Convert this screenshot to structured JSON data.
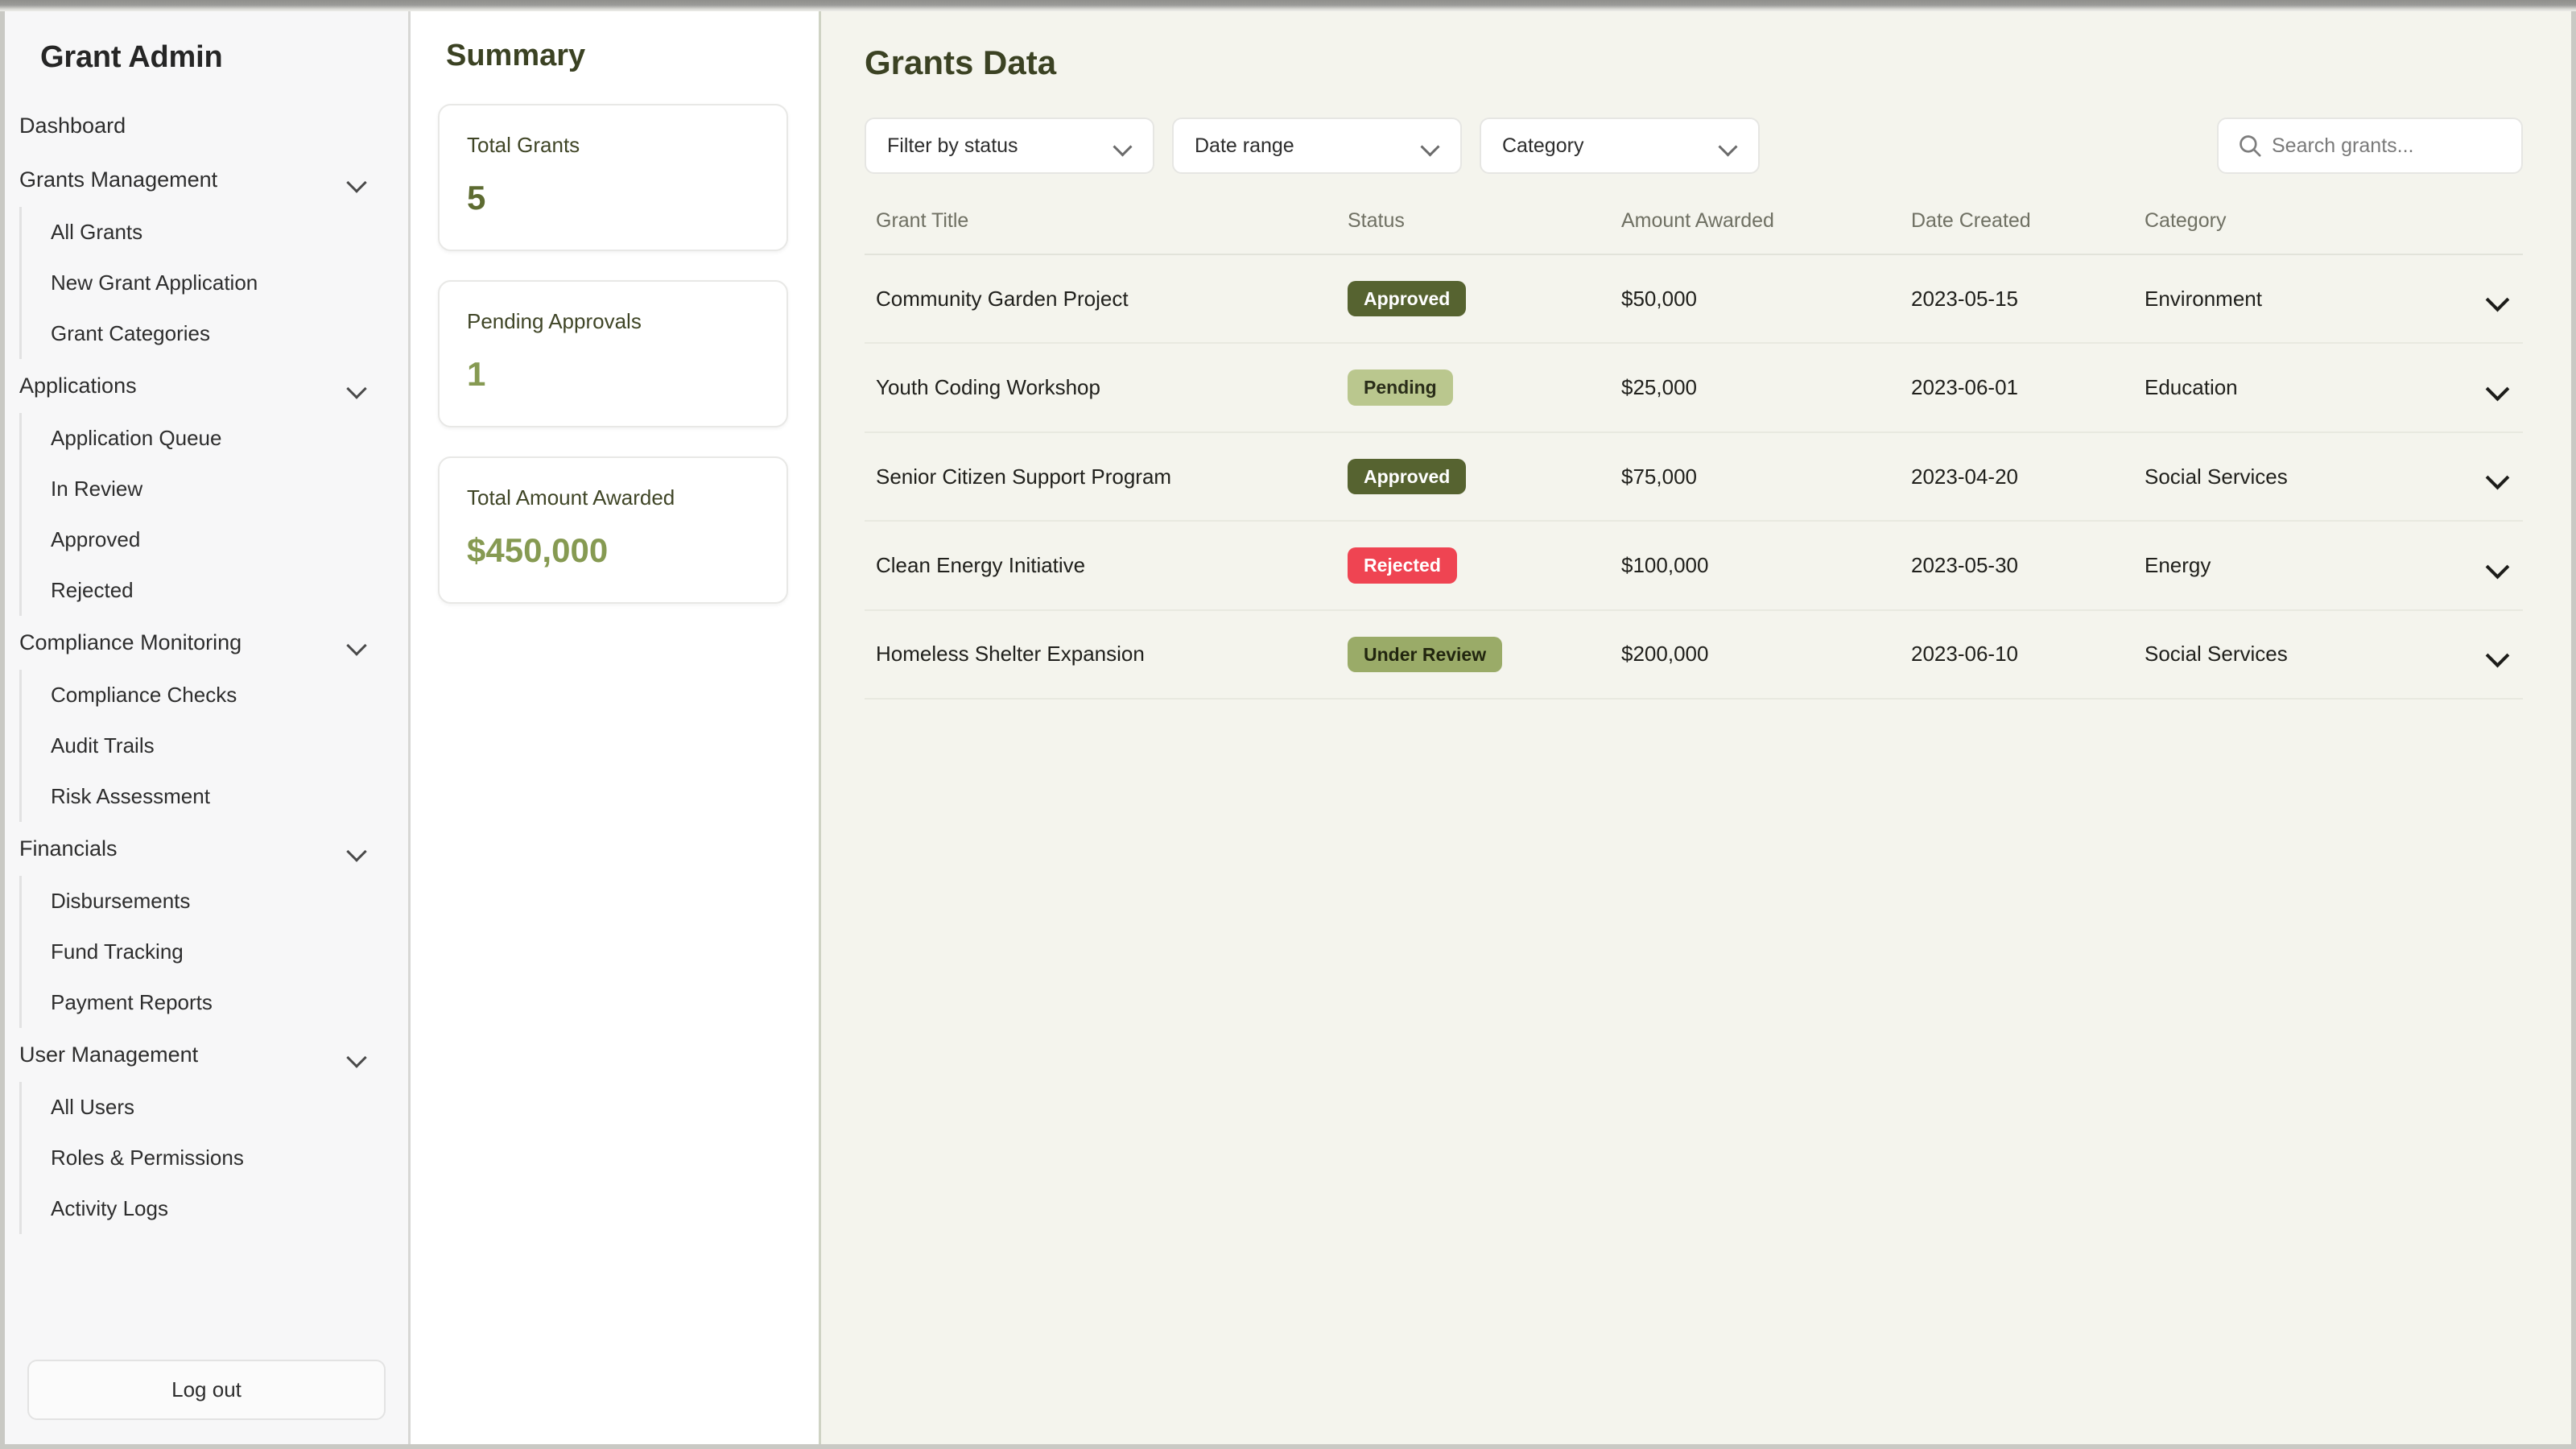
{
  "sidebar": {
    "title": "Grant Admin",
    "logout_label": "Log out",
    "items": [
      {
        "label": "Dashboard",
        "type": "link",
        "children": []
      },
      {
        "label": "Grants Management",
        "type": "group",
        "icon": "chevron-down-icon",
        "children": [
          "All Grants",
          "New Grant Application",
          "Grant Categories"
        ]
      },
      {
        "label": "Applications",
        "type": "group",
        "icon": "chevron-down-icon",
        "children": [
          "Application Queue",
          "In Review",
          "Approved",
          "Rejected"
        ]
      },
      {
        "label": "Compliance Monitoring",
        "type": "group",
        "icon": "chevron-down-icon",
        "children": [
          "Compliance Checks",
          "Audit Trails",
          "Risk Assessment"
        ]
      },
      {
        "label": "Financials",
        "type": "group",
        "icon": "chevron-down-icon",
        "children": [
          "Disbursements",
          "Fund Tracking",
          "Payment Reports"
        ]
      },
      {
        "label": "User Management",
        "type": "group",
        "icon": "chevron-down-icon",
        "children": [
          "All Users",
          "Roles & Permissions",
          "Activity Logs"
        ]
      }
    ]
  },
  "summary": {
    "title": "Summary",
    "cards": [
      {
        "label": "Total Grants",
        "value": "5",
        "tone": "dark"
      },
      {
        "label": "Pending Approvals",
        "value": "1",
        "tone": "light"
      },
      {
        "label": "Total Amount Awarded",
        "value": "$450,000",
        "tone": "light"
      }
    ]
  },
  "main": {
    "title": "Grants Data",
    "filters": [
      {
        "label": "Filter by status",
        "icon": "chevron-down-icon"
      },
      {
        "label": "Date range",
        "icon": "chevron-down-icon"
      },
      {
        "label": "Category",
        "icon": "chevron-down-icon"
      }
    ],
    "search": {
      "placeholder": "Search grants...",
      "value": "",
      "icon": "search-icon"
    },
    "table": {
      "columns": [
        "Grant Title",
        "Status",
        "Amount Awarded",
        "Date Created",
        "Category"
      ],
      "rows": [
        {
          "title": "Community Garden Project",
          "status": "Approved",
          "status_key": "approved",
          "amount": "$50,000",
          "date": "2023-05-15",
          "category": "Environment"
        },
        {
          "title": "Youth Coding Workshop",
          "status": "Pending",
          "status_key": "pending",
          "amount": "$25,000",
          "date": "2023-06-01",
          "category": "Education"
        },
        {
          "title": "Senior Citizen Support Program",
          "status": "Approved",
          "status_key": "approved",
          "amount": "$75,000",
          "date": "2023-04-20",
          "category": "Social Services"
        },
        {
          "title": "Clean Energy Initiative",
          "status": "Rejected",
          "status_key": "rejected",
          "amount": "$100,000",
          "date": "2023-05-30",
          "category": "Energy"
        },
        {
          "title": "Homeless Shelter Expansion",
          "status": "Under Review",
          "status_key": "under-review",
          "amount": "$200,000",
          "date": "2023-06-10",
          "category": "Social Services"
        }
      ]
    }
  },
  "colors": {
    "accent_dark": "#566330",
    "accent_light": "#869a52",
    "badge_pending": "#bac78e",
    "badge_under_review": "#9aab68",
    "badge_rejected": "#ef4452",
    "main_bg": "#f4f4ed",
    "sidebar_bg": "#f7f7f8"
  }
}
